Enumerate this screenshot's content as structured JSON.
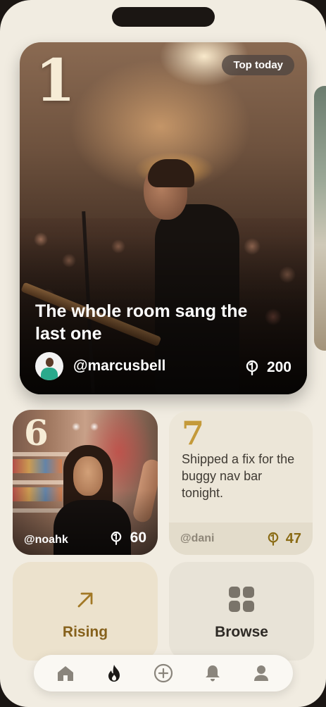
{
  "hero": {
    "rank": "1",
    "badge": "Top today",
    "title": "The whole room sang the last one",
    "handle": "@marcusbell",
    "likes": "200"
  },
  "card_left": {
    "rank": "6",
    "handle": "@noahk",
    "likes": "60"
  },
  "card_right": {
    "rank": "7",
    "text": "Shipped a fix for the buggy nav bar tonight.",
    "handle": "@dani",
    "likes": "47"
  },
  "tiles": {
    "rising_label": "Rising",
    "browse_label": "Browse"
  },
  "nav": {
    "items": [
      "home-icon",
      "flame-icon",
      "plus-circle-icon",
      "bell-icon",
      "profile-icon"
    ],
    "active": "flame-icon"
  },
  "colors": {
    "background": "#f1ece1",
    "gold": "#c49a3a",
    "rising_text": "#86611c"
  }
}
